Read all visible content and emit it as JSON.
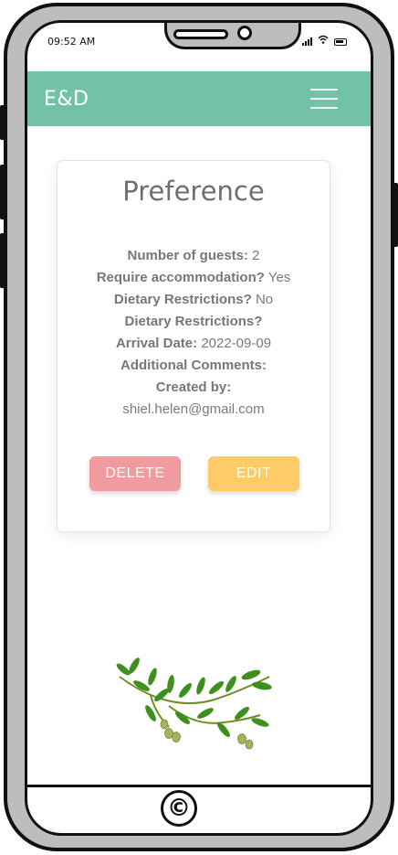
{
  "status_bar": {
    "time": "09:52 AM",
    "icons": [
      "signal-icon",
      "wifi-icon",
      "battery-icon"
    ]
  },
  "navbar": {
    "brand": "E&D",
    "menu_icon": "hamburger-menu-icon",
    "background": "#73c2a8"
  },
  "card": {
    "title": "Preference",
    "fields": [
      {
        "label": "Number of guests:",
        "value": "2"
      },
      {
        "label": "Require accommodation?",
        "value": "Yes"
      },
      {
        "label": "Dietary Restrictions?",
        "value": "No"
      },
      {
        "label": "Dietary Restrictions?",
        "value": ""
      },
      {
        "label": "Arrival Date:",
        "value": "2022-09-09"
      },
      {
        "label": "Additional Comments:",
        "value": ""
      },
      {
        "label": "Created by:",
        "value": ""
      }
    ],
    "creator_email": "shiel.helen@gmail.com",
    "delete_label": "DELETE",
    "edit_label": "EDIT",
    "delete_color": "#ef9b9f",
    "edit_color": "#fdcc68"
  },
  "footer": {
    "copyright_symbol": "©"
  }
}
